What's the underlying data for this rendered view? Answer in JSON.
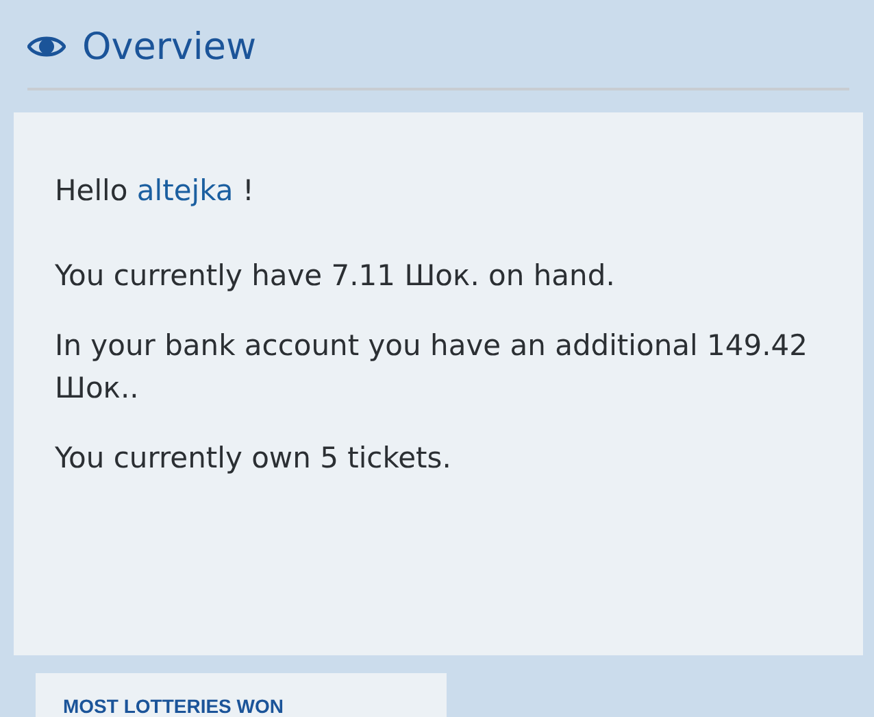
{
  "header": {
    "title": "Overview"
  },
  "greeting": {
    "prefix": "Hello",
    "user": "altejka",
    "suffix": "!"
  },
  "paragraphs": [
    "You currently have 7.11 Шок. on hand.",
    "In your bank account you have an additional 149.42 Шок..",
    "You currently own 5 tickets."
  ],
  "next_card": {
    "title": "MOST LOTTERIES WON"
  }
}
